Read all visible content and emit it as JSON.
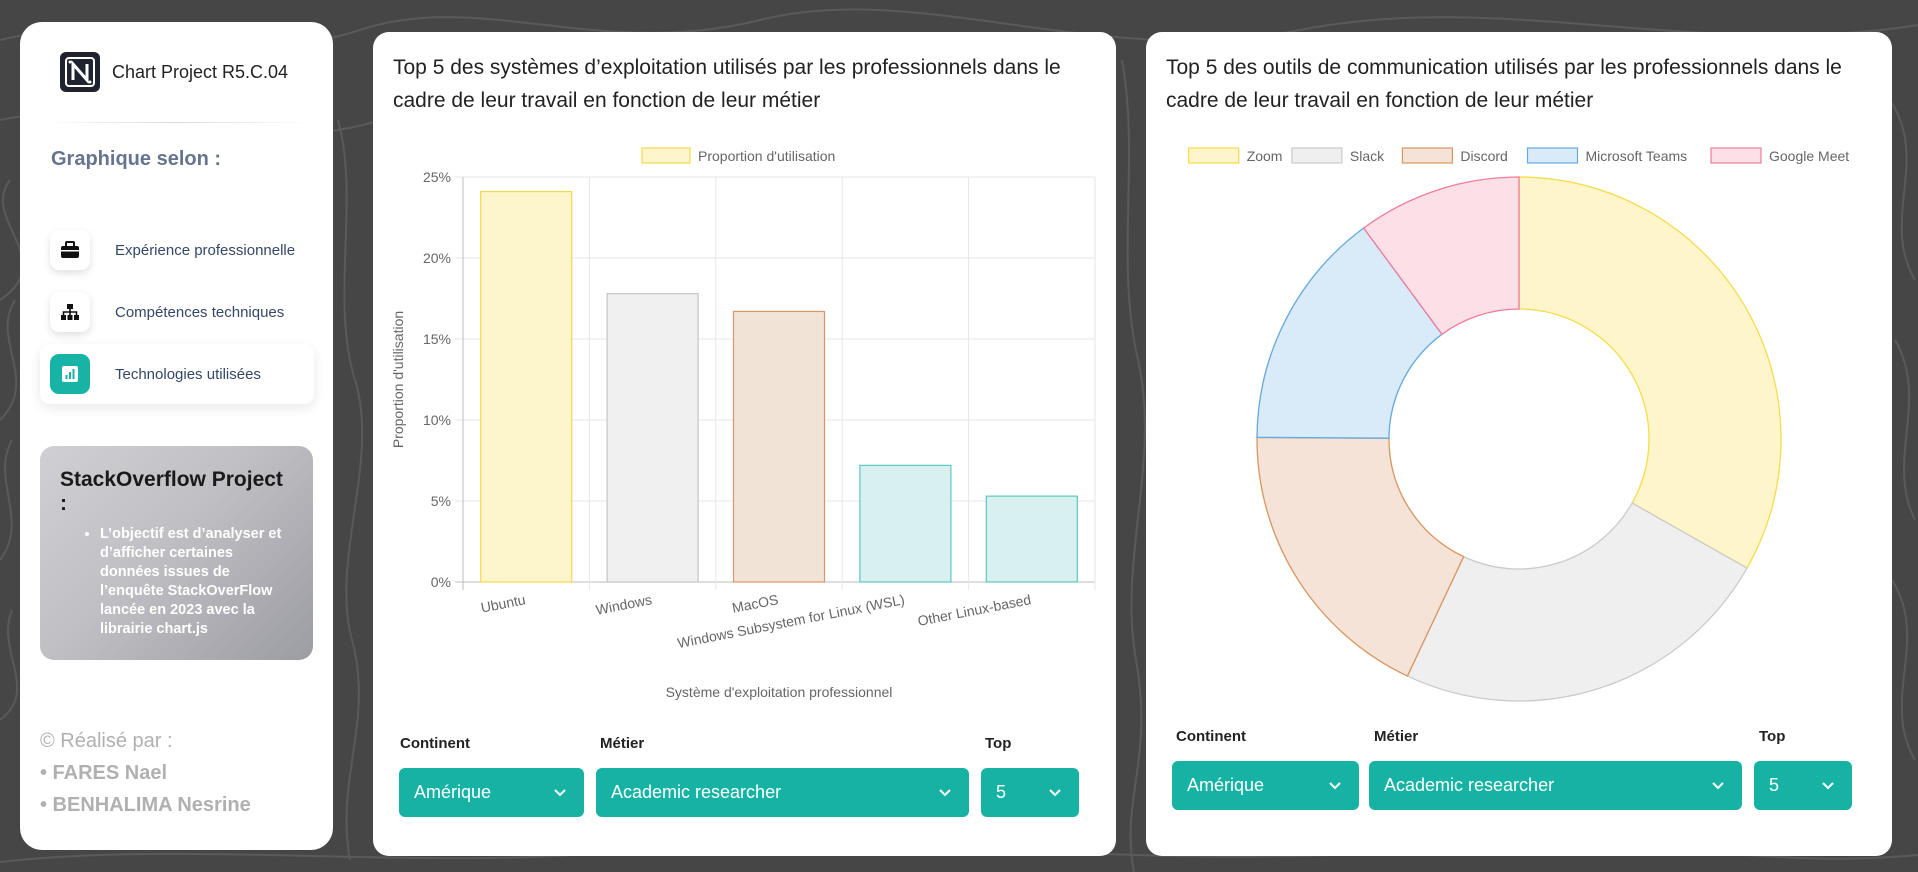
{
  "app": {
    "title": "Chart Project R5.C.04"
  },
  "sidebar": {
    "section_title": "Graphique selon :",
    "items": [
      {
        "label": "Expérience professionnelle",
        "icon": "briefcase-icon",
        "active": false
      },
      {
        "label": "Compétences techniques",
        "icon": "sitemap-icon",
        "active": false
      },
      {
        "label": "Technologies utilisées",
        "icon": "chart-icon",
        "active": true
      }
    ],
    "info": {
      "title": "StackOverflow Project :",
      "text": "L’objectif est d’analyser et d’afficher certaines données issues de l’enquête StackOverFlow lancée en 2023 avec la librairie chart.js"
    },
    "credits": {
      "heading": "© Réalisé par :",
      "authors": [
        "• FARES Nael",
        "• BENHALIMA Nesrine"
      ]
    }
  },
  "left_card": {
    "title": "Top 5 des systèmes d’exploitation utilisés par les professionnels dans le cadre de leur travail en fonction de leur métier",
    "controls": {
      "continent_label": "Continent",
      "continent_value": "Amérique",
      "metier_label": "Métier",
      "metier_value": "Academic researcher",
      "top_label": "Top",
      "top_value": "5"
    }
  },
  "right_card": {
    "title": "Top 5 des outils de communication utilisés par les professionnels dans le cadre de leur travail en fonction de leur métier",
    "controls": {
      "continent_label": "Continent",
      "continent_value": "Amérique",
      "metier_label": "Métier",
      "metier_value": "Academic researcher",
      "top_label": "Top",
      "top_value": "5"
    }
  },
  "chart_data": [
    {
      "type": "bar",
      "categories": [
        "Ubuntu",
        "Windows",
        "MacOS",
        "Windows Subsystem for Linux (WSL)",
        "Other Linux-based"
      ],
      "series": [
        {
          "name": "Proportion d'utilisation",
          "values": [
            24.1,
            17.8,
            16.7,
            7.2,
            5.3
          ]
        }
      ],
      "xlabel": "Système d'exploitation professionnel",
      "ylabel": "Proportion d'utilisation",
      "yticks": [
        "0%",
        "5%",
        "10%",
        "15%",
        "20%",
        "25%"
      ],
      "ylim": [
        0,
        25
      ],
      "grid": true,
      "legend": "top",
      "fills": [
        "#fdf5cc",
        "#f0f0f0",
        "#f2e3d7",
        "#d8f1f0",
        "#d8f1f0"
      ],
      "strokes": [
        "#f5d94d",
        "#c4c4c4",
        "#d9956a",
        "#5dc7c2",
        "#5dc7c2"
      ]
    },
    {
      "type": "pie",
      "labels": [
        "Zoom",
        "Slack",
        "Discord",
        "Microsoft Teams",
        "Google Meet"
      ],
      "values": [
        33.2,
        23.8,
        18.1,
        14.8,
        10.1
      ],
      "legend": "top",
      "fills": [
        "#fef6ca",
        "#efefef",
        "#f4e3d6",
        "#d9ebf8",
        "#fde0e7"
      ],
      "strokes": [
        "#f6dc4b",
        "#cacaca",
        "#d9955f",
        "#64a9df",
        "#ef7b9a"
      ]
    }
  ]
}
